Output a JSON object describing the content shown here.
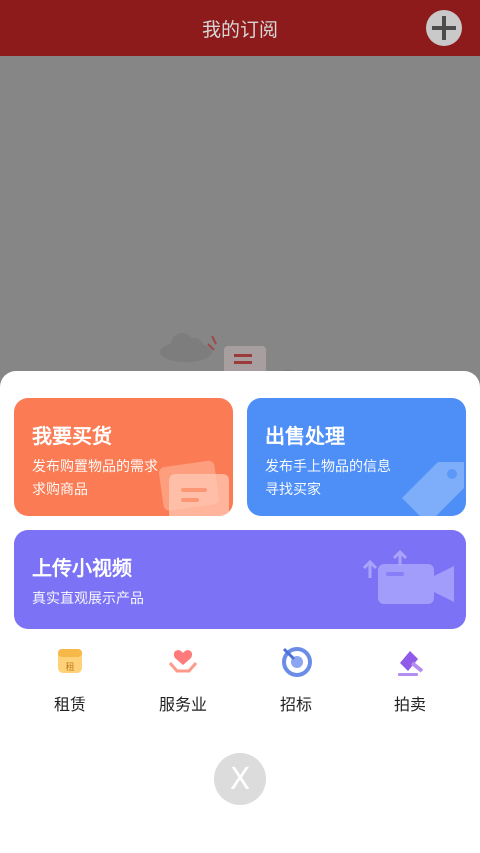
{
  "header": {
    "title": "我的订阅",
    "add_icon": "plus-icon"
  },
  "cards": {
    "buy": {
      "title": "我要买货",
      "line1": "发布购置物品的需求",
      "line2": "求购商品",
      "color": "#fb7b54"
    },
    "sell": {
      "title": "出售处理",
      "line1": "发布手上物品的信息",
      "line2": "寻找买家",
      "color": "#4e8ff7"
    },
    "video": {
      "title": "上传小视频",
      "line1": "真实直观展示产品",
      "color": "#7b72f5"
    }
  },
  "services": [
    {
      "label": "租赁",
      "icon": "rent-bag-icon"
    },
    {
      "label": "服务业",
      "icon": "service-hands-icon"
    },
    {
      "label": "招标",
      "icon": "target-icon"
    },
    {
      "label": "拍卖",
      "icon": "auction-hammer-icon"
    }
  ],
  "close": {
    "label": "X",
    "icon": "close-icon"
  }
}
